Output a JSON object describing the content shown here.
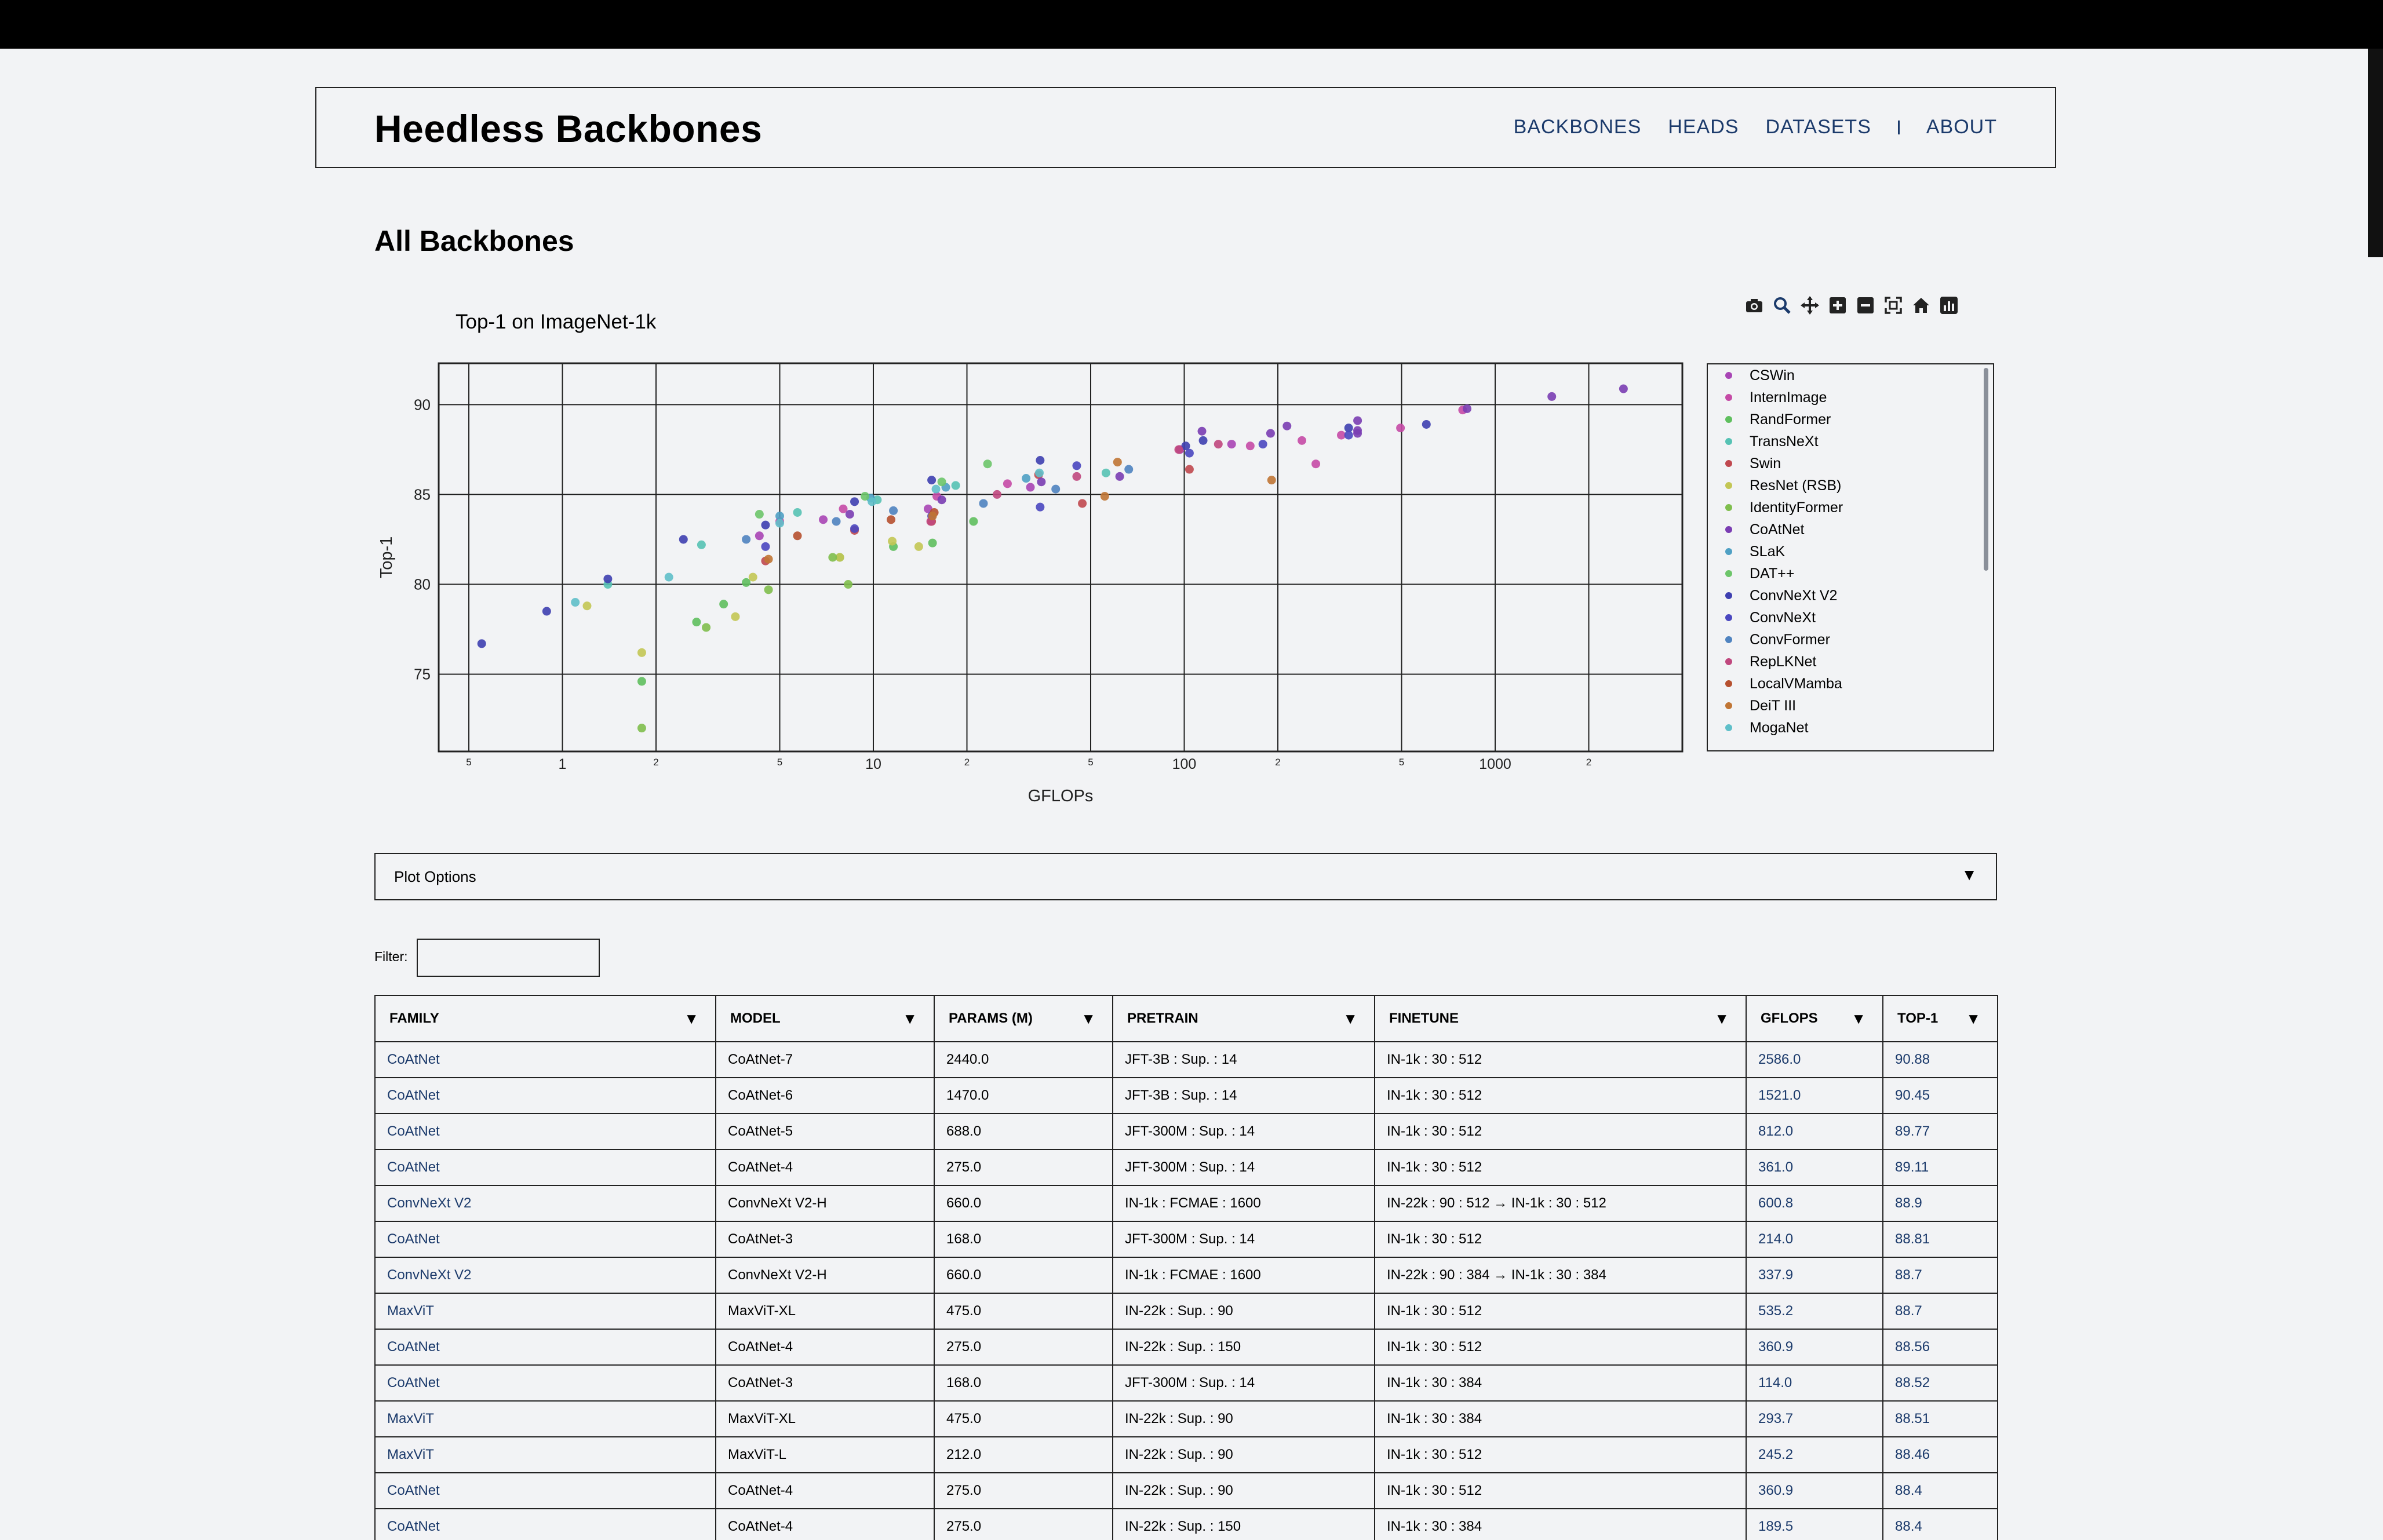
{
  "site": {
    "title": "Heedless Backbones"
  },
  "nav": {
    "items": [
      "BACKBONES",
      "HEADS",
      "DATASETS",
      "ABOUT"
    ]
  },
  "page": {
    "heading": "All Backbones"
  },
  "toolbar": {
    "icons": [
      "camera-icon",
      "zoom-icon",
      "pan-icon",
      "zoom-in-icon",
      "zoom-out-icon",
      "autoscale-icon",
      "home-icon",
      "plotly-logo-icon"
    ]
  },
  "chart_data": {
    "type": "scatter",
    "title": "Top-1 on ImageNet-1k",
    "xlabel": "GFLOPs",
    "ylabel": "Top-1",
    "x_scale": "log",
    "xlim": [
      0.4,
      4000
    ],
    "ylim": [
      70.7,
      92.3
    ],
    "x_tick_labels": [
      {
        "v": 0.5,
        "t": "5",
        "minor": true
      },
      {
        "v": 1,
        "t": "1"
      },
      {
        "v": 2,
        "t": "2",
        "minor": true
      },
      {
        "v": 5,
        "t": "5",
        "minor": true
      },
      {
        "v": 10,
        "t": "10"
      },
      {
        "v": 20,
        "t": "2",
        "minor": true
      },
      {
        "v": 50,
        "t": "5",
        "minor": true
      },
      {
        "v": 100,
        "t": "100"
      },
      {
        "v": 200,
        "t": "2",
        "minor": true
      },
      {
        "v": 500,
        "t": "5",
        "minor": true
      },
      {
        "v": 1000,
        "t": "1000"
      },
      {
        "v": 2000,
        "t": "2",
        "minor": true
      }
    ],
    "y_ticks": [
      75,
      80,
      85,
      90
    ],
    "grid": true,
    "legend_position": "right",
    "series": [
      {
        "name": "CSWin",
        "color": "#a845b5",
        "points": [
          [
            4.3,
            82.7
          ],
          [
            6.9,
            83.6
          ],
          [
            15.0,
            84.2
          ],
          [
            32.0,
            85.4
          ],
          [
            96.8,
            87.5
          ],
          [
            142.0,
            87.8
          ]
        ]
      },
      {
        "name": "InternImage",
        "color": "#c54aa6",
        "points": [
          [
            5.0,
            83.5
          ],
          [
            8.0,
            84.2
          ],
          [
            16.0,
            84.9
          ],
          [
            27.0,
            85.6
          ],
          [
            163.0,
            87.7
          ],
          [
            239.0,
            88.0
          ],
          [
            265.0,
            86.7
          ],
          [
            320.0,
            88.3
          ],
          [
            496.0,
            88.7
          ],
          [
            786.0,
            89.7
          ]
        ]
      },
      {
        "name": "RandFormer",
        "color": "#5fbf5e",
        "points": [
          [
            1.8,
            74.6
          ],
          [
            2.7,
            77.9
          ],
          [
            3.3,
            78.9
          ],
          [
            3.9,
            80.1
          ],
          [
            7.8,
            81.5
          ],
          [
            11.6,
            82.1
          ],
          [
            15.5,
            82.3
          ],
          [
            21.0,
            83.5
          ]
        ]
      },
      {
        "name": "TransNeXt",
        "color": "#56c2b4",
        "points": [
          [
            1.4,
            80.0
          ],
          [
            2.8,
            82.2
          ],
          [
            5.7,
            84.0
          ],
          [
            10.3,
            84.7
          ],
          [
            18.4,
            85.5
          ],
          [
            56.0,
            86.2
          ]
        ]
      },
      {
        "name": "Swin",
        "color": "#c0484f",
        "points": [
          [
            4.5,
            81.3
          ],
          [
            8.7,
            83.0
          ],
          [
            15.4,
            83.5
          ],
          [
            47.0,
            84.5
          ],
          [
            103.9,
            86.4
          ],
          [
            34.0,
            86.1
          ]
        ]
      },
      {
        "name": "ResNet (RSB)",
        "color": "#c3c654",
        "points": [
          [
            1.2,
            78.8
          ],
          [
            1.8,
            76.2
          ],
          [
            3.6,
            78.2
          ],
          [
            4.1,
            80.4
          ],
          [
            7.8,
            81.5
          ],
          [
            11.5,
            82.4
          ],
          [
            14.0,
            82.1
          ]
        ]
      },
      {
        "name": "IdentityFormer",
        "color": "#7fbe4d",
        "points": [
          [
            1.8,
            72.0
          ],
          [
            2.9,
            77.6
          ],
          [
            4.6,
            79.7
          ],
          [
            7.4,
            81.5
          ],
          [
            8.3,
            80.0
          ]
        ]
      },
      {
        "name": "CoAtNet",
        "color": "#7a3db3",
        "points": [
          [
            2586.0,
            90.88
          ],
          [
            1521.0,
            90.45
          ],
          [
            812.0,
            89.77
          ],
          [
            361.0,
            89.11
          ],
          [
            214.0,
            88.81
          ],
          [
            360.9,
            88.56
          ],
          [
            114.0,
            88.52
          ],
          [
            360.9,
            88.4
          ],
          [
            189.5,
            88.4
          ],
          [
            8.4,
            83.9
          ],
          [
            16.6,
            84.7
          ],
          [
            34.7,
            85.7
          ],
          [
            62.0,
            86.0
          ]
        ]
      },
      {
        "name": "SLaK",
        "color": "#4fa0c4",
        "points": [
          [
            5.0,
            83.8
          ],
          [
            9.8,
            84.8
          ],
          [
            17.1,
            85.4
          ],
          [
            31.0,
            85.9
          ]
        ]
      },
      {
        "name": "DAT++",
        "color": "#6dc56a",
        "points": [
          [
            4.3,
            83.9
          ],
          [
            9.4,
            84.9
          ],
          [
            16.6,
            85.7
          ],
          [
            23.3,
            86.7
          ]
        ]
      },
      {
        "name": "ConvNeXt V2",
        "color": "#3e3fb0",
        "points": [
          [
            0.55,
            76.7
          ],
          [
            0.89,
            78.5
          ],
          [
            1.4,
            80.3
          ],
          [
            2.45,
            82.5
          ],
          [
            4.5,
            83.3
          ],
          [
            8.7,
            84.6
          ],
          [
            15.4,
            85.8
          ],
          [
            34.4,
            86.9
          ],
          [
            600.8,
            88.9
          ],
          [
            337.9,
            88.7
          ],
          [
            101.1,
            87.7
          ],
          [
            115.0,
            88.0
          ]
        ]
      },
      {
        "name": "ConvNeXt",
        "color": "#4a47c0",
        "points": [
          [
            4.5,
            82.1
          ],
          [
            8.7,
            83.1
          ],
          [
            15.4,
            83.8
          ],
          [
            34.4,
            84.3
          ],
          [
            45.1,
            86.6
          ],
          [
            103.9,
            87.3
          ],
          [
            179.0,
            87.8
          ],
          [
            337.9,
            88.3
          ]
        ]
      },
      {
        "name": "ConvFormer",
        "color": "#4f83c0",
        "points": [
          [
            3.9,
            82.5
          ],
          [
            7.6,
            83.5
          ],
          [
            11.6,
            84.1
          ],
          [
            22.6,
            84.5
          ],
          [
            38.6,
            85.3
          ],
          [
            66.3,
            86.4
          ]
        ]
      },
      {
        "name": "RepLKNet",
        "color": "#c0477e",
        "points": [
          [
            15.3,
            83.5
          ],
          [
            25.0,
            85.0
          ],
          [
            45.1,
            86.0
          ],
          [
            96.0,
            87.5
          ],
          [
            128.7,
            87.8
          ]
        ]
      },
      {
        "name": "LocalVMamba",
        "color": "#b6502f",
        "points": [
          [
            5.7,
            82.7
          ],
          [
            11.4,
            83.6
          ],
          [
            15.7,
            84.0
          ]
        ]
      },
      {
        "name": "DeiT III",
        "color": "#c07535",
        "points": [
          [
            4.6,
            81.4
          ],
          [
            15.5,
            83.8
          ],
          [
            55.5,
            84.9
          ],
          [
            191.0,
            85.8
          ],
          [
            61.0,
            86.8
          ]
        ]
      },
      {
        "name": "MogaNet",
        "color": "#5fbfc9",
        "points": [
          [
            1.1,
            79.0
          ],
          [
            2.2,
            80.4
          ],
          [
            5.0,
            83.4
          ],
          [
            9.9,
            84.6
          ],
          [
            15.9,
            85.3
          ],
          [
            34.2,
            86.2
          ]
        ]
      }
    ]
  },
  "plot_options": {
    "label": "Plot Options",
    "arrow": "▼"
  },
  "filter": {
    "label": "Filter:",
    "value": ""
  },
  "table": {
    "sort_glyph": "▼",
    "columns": [
      "FAMILY",
      "MODEL",
      "PARAMS (M)",
      "PRETRAIN",
      "FINETUNE",
      "GFLOPS",
      "TOP-1"
    ],
    "rows": [
      [
        "CoAtNet",
        "CoAtNet-7",
        "2440.0",
        "JFT-3B : Sup. : 14",
        "IN-1k : 30 : 512",
        "2586.0",
        "90.88"
      ],
      [
        "CoAtNet",
        "CoAtNet-6",
        "1470.0",
        "JFT-3B : Sup. : 14",
        "IN-1k : 30 : 512",
        "1521.0",
        "90.45"
      ],
      [
        "CoAtNet",
        "CoAtNet-5",
        "688.0",
        "JFT-300M : Sup. : 14",
        "IN-1k : 30 : 512",
        "812.0",
        "89.77"
      ],
      [
        "CoAtNet",
        "CoAtNet-4",
        "275.0",
        "JFT-300M : Sup. : 14",
        "IN-1k : 30 : 512",
        "361.0",
        "89.11"
      ],
      [
        "ConvNeXt V2",
        "ConvNeXt V2-H",
        "660.0",
        "IN-1k : FCMAE : 1600",
        "IN-22k : 90 : 512 → IN-1k : 30 : 512",
        "600.8",
        "88.9"
      ],
      [
        "CoAtNet",
        "CoAtNet-3",
        "168.0",
        "JFT-300M : Sup. : 14",
        "IN-1k : 30 : 512",
        "214.0",
        "88.81"
      ],
      [
        "ConvNeXt V2",
        "ConvNeXt V2-H",
        "660.0",
        "IN-1k : FCMAE : 1600",
        "IN-22k : 90 : 384 → IN-1k : 30 : 384",
        "337.9",
        "88.7"
      ],
      [
        "MaxViT",
        "MaxViT-XL",
        "475.0",
        "IN-22k : Sup. : 90",
        "IN-1k : 30 : 512",
        "535.2",
        "88.7"
      ],
      [
        "CoAtNet",
        "CoAtNet-4",
        "275.0",
        "IN-22k : Sup. : 150",
        "IN-1k : 30 : 512",
        "360.9",
        "88.56"
      ],
      [
        "CoAtNet",
        "CoAtNet-3",
        "168.0",
        "JFT-300M : Sup. : 14",
        "IN-1k : 30 : 384",
        "114.0",
        "88.52"
      ],
      [
        "MaxViT",
        "MaxViT-XL",
        "475.0",
        "IN-22k : Sup. : 90",
        "IN-1k : 30 : 384",
        "293.7",
        "88.51"
      ],
      [
        "MaxViT",
        "MaxViT-L",
        "212.0",
        "IN-22k : Sup. : 90",
        "IN-1k : 30 : 512",
        "245.2",
        "88.46"
      ],
      [
        "CoAtNet",
        "CoAtNet-4",
        "275.0",
        "IN-22k : Sup. : 90",
        "IN-1k : 30 : 512",
        "360.9",
        "88.4"
      ],
      [
        "CoAtNet",
        "CoAtNet-4",
        "275.0",
        "IN-22k : Sup. : 150",
        "IN-1k : 30 : 384",
        "189.5",
        "88.4"
      ]
    ]
  }
}
